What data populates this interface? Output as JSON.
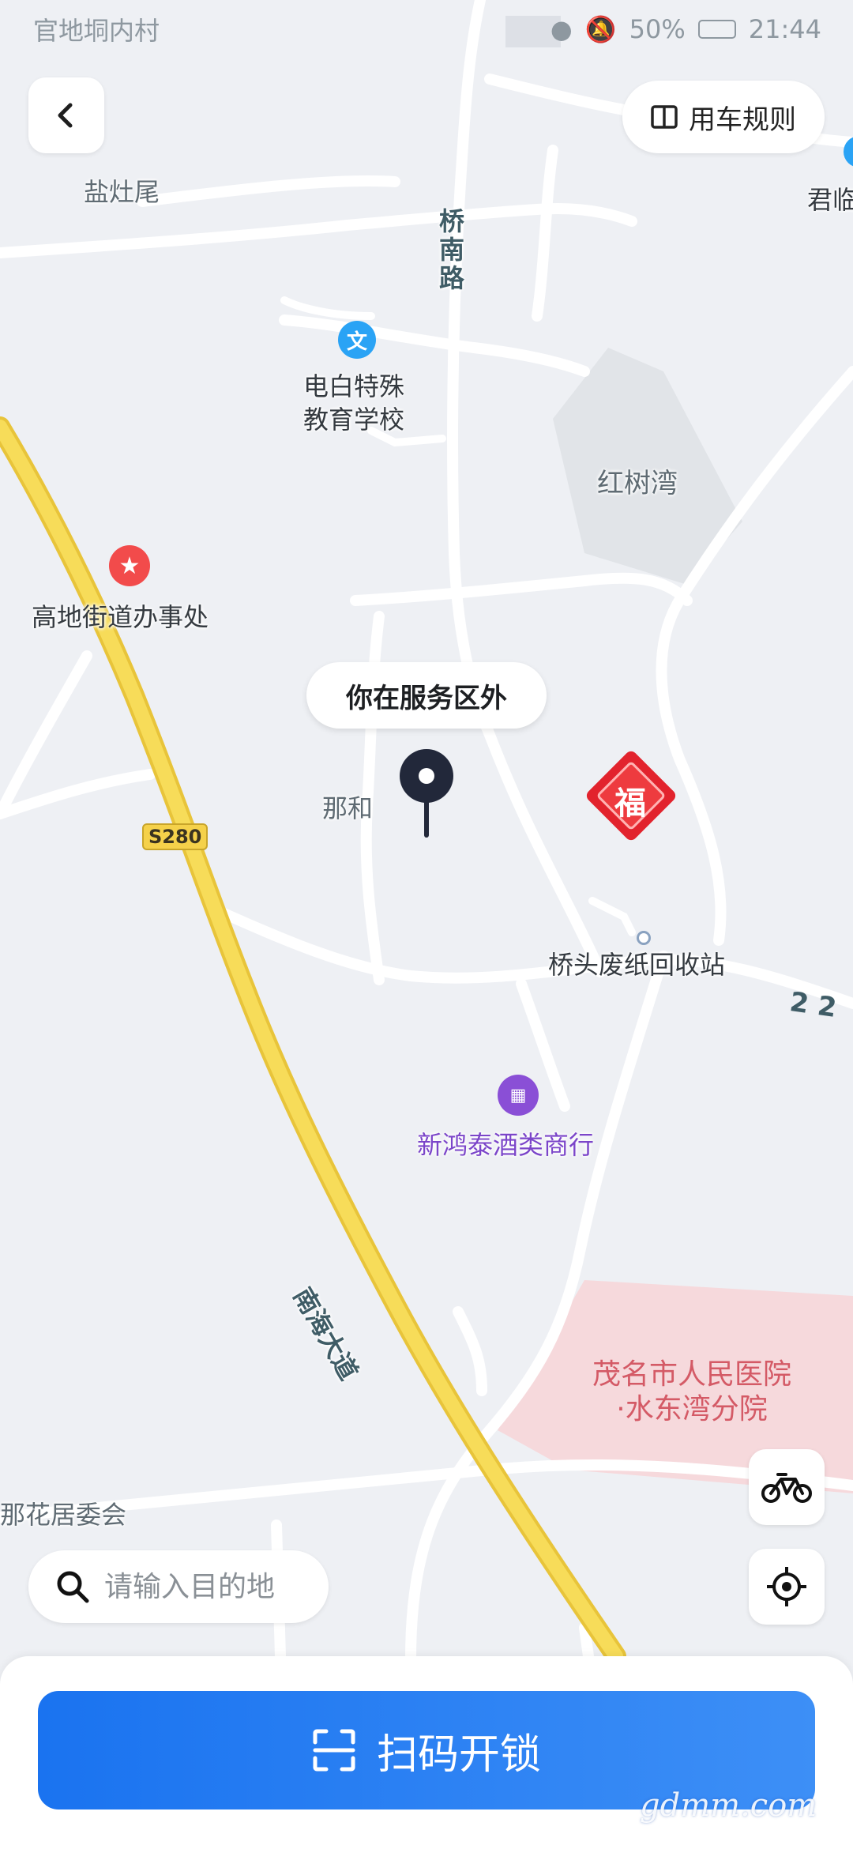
{
  "status_bar": {
    "carrier": "官地垌内村",
    "battery": "50%",
    "time": "21:44"
  },
  "header": {
    "rules_label": "用车规则"
  },
  "map": {
    "labels": {
      "yanzaowei": "盐灶尾",
      "qiaonan_road": "桥南路",
      "school_line1": "电白特殊",
      "school_line2": "教育学校",
      "hongshuwan": "红树湾",
      "gaodi_office": "高地街道办事处",
      "nahe": "那和",
      "route_s280": "S280",
      "recycling": "桥头废纸回收站",
      "road_22": "2 2",
      "liquor_shop": "新鸿泰酒类商行",
      "nanhai_avenue": "南海大道",
      "hospital_line1": "茂名市人民医院",
      "hospital_line2": "·水东湾分院",
      "nahua": "那花居委会",
      "junlin": "君临",
      "fu": "福"
    },
    "callout": "你在服务区外"
  },
  "search": {
    "placeholder": "请输入目的地"
  },
  "action": {
    "scan_label": "扫码开锁"
  },
  "watermark": "gdmm.com",
  "colors": {
    "primary": "#1a73f0",
    "highway": "#f5d64a",
    "hospital_zone": "#f6d9dc",
    "poi_red": "#f24b4b",
    "poi_blue": "#2aa3f5",
    "poi_purple": "#8a4fd6",
    "liquor_text": "#7b45c9",
    "pin": "#22283a"
  },
  "icons": {
    "back": "chevron-left-icon",
    "rules": "book-icon",
    "bike": "bicycle-icon",
    "locate": "crosshair-icon",
    "search": "search-icon",
    "scan": "scan-icon"
  }
}
